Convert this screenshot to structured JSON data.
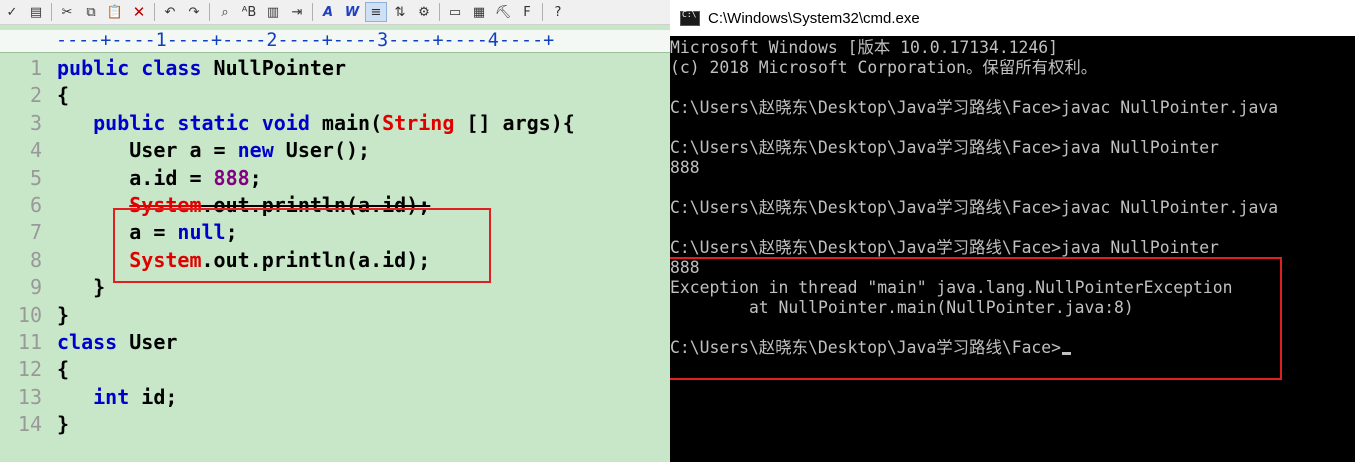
{
  "editor": {
    "toolbar": [
      {
        "name": "spellcheck-icon",
        "glyph": "✓"
      },
      {
        "name": "print-preview-icon",
        "glyph": "▤"
      },
      {
        "name": "cut-icon",
        "glyph": "✂"
      },
      {
        "name": "copy-icon",
        "glyph": "⧉"
      },
      {
        "name": "paste-icon",
        "glyph": "📋"
      },
      {
        "name": "delete-icon",
        "glyph": "✕"
      },
      {
        "name": "undo-icon",
        "glyph": "↶"
      },
      {
        "name": "redo-icon",
        "glyph": "↷"
      },
      {
        "name": "find-icon",
        "glyph": "⌕"
      },
      {
        "name": "replace-icon",
        "glyph": "ᴬB"
      },
      {
        "name": "copy-block-icon",
        "glyph": "▥"
      },
      {
        "name": "indent-icon",
        "glyph": "⇥"
      },
      {
        "name": "font-icon",
        "glyph": "A"
      },
      {
        "name": "word-wrap-icon",
        "glyph": "W"
      },
      {
        "name": "align-icon",
        "glyph": "≡"
      },
      {
        "name": "sort-icon",
        "glyph": "⇅"
      },
      {
        "name": "settings-icon",
        "glyph": "⚙"
      },
      {
        "name": "view-icon",
        "glyph": "▭"
      },
      {
        "name": "column-icon",
        "glyph": "▦"
      },
      {
        "name": "tools-icon",
        "glyph": "⛏"
      },
      {
        "name": "file-icon",
        "glyph": "F"
      },
      {
        "name": "help-icon",
        "glyph": "?"
      }
    ],
    "ruler": "----+----1----+----2----+----3----+----4----+",
    "lines": [
      {
        "num": "1",
        "segments": [
          {
            "t": "public class ",
            "c": "kw"
          },
          {
            "t": "NullPointer",
            "c": ""
          }
        ]
      },
      {
        "num": "2",
        "segments": [
          {
            "t": "{",
            "c": ""
          }
        ]
      },
      {
        "num": "3",
        "segments": [
          {
            "t": "   public static void ",
            "c": "kw"
          },
          {
            "t": "main(",
            "c": ""
          },
          {
            "t": "String",
            "c": "ty"
          },
          {
            "t": " [] args){",
            "c": ""
          }
        ]
      },
      {
        "num": "4",
        "segments": [
          {
            "t": "      User a = ",
            "c": ""
          },
          {
            "t": "new",
            "c": "kw"
          },
          {
            "t": " User();",
            "c": ""
          }
        ]
      },
      {
        "num": "5",
        "segments": [
          {
            "t": "      a.id = ",
            "c": ""
          },
          {
            "t": "888",
            "c": "num"
          },
          {
            "t": ";",
            "c": ""
          }
        ]
      },
      {
        "num": "6",
        "segments": [
          {
            "t": "      ",
            "c": ""
          },
          {
            "t": "System",
            "c": "ty strike"
          },
          {
            "t": ".out.println(a.id);",
            "c": "strike"
          }
        ]
      },
      {
        "num": "7",
        "segments": [
          {
            "t": "      a = ",
            "c": ""
          },
          {
            "t": "null",
            "c": "kw"
          },
          {
            "t": ";",
            "c": ""
          }
        ]
      },
      {
        "num": "8",
        "segments": [
          {
            "t": "      ",
            "c": ""
          },
          {
            "t": "System",
            "c": "ty"
          },
          {
            "t": ".out.println(a.id);",
            "c": ""
          }
        ]
      },
      {
        "num": "9",
        "segments": [
          {
            "t": "   }",
            "c": ""
          }
        ]
      },
      {
        "num": "10",
        "segments": [
          {
            "t": "}",
            "c": ""
          }
        ]
      },
      {
        "num": "11",
        "segments": [
          {
            "t": "class ",
            "c": "kw"
          },
          {
            "t": "User",
            "c": ""
          }
        ]
      },
      {
        "num": "12",
        "segments": [
          {
            "t": "{",
            "c": ""
          }
        ]
      },
      {
        "num": "13",
        "segments": [
          {
            "t": "   ",
            "c": ""
          },
          {
            "t": "int",
            "c": "kw"
          },
          {
            "t": " id;",
            "c": ""
          }
        ]
      },
      {
        "num": "14",
        "segments": [
          {
            "t": "}",
            "c": ""
          }
        ]
      }
    ]
  },
  "cmd": {
    "title": "C:\\Windows\\System32\\cmd.exe",
    "lines": [
      "Microsoft Windows [版本 10.0.17134.1246]",
      "(c) 2018 Microsoft Corporation。保留所有权利。",
      "",
      "C:\\Users\\赵晓东\\Desktop\\Java学习路线\\Face>javac NullPointer.java",
      "",
      "C:\\Users\\赵晓东\\Desktop\\Java学习路线\\Face>java NullPointer",
      "888",
      "",
      "C:\\Users\\赵晓东\\Desktop\\Java学习路线\\Face>javac NullPointer.java",
      "",
      "C:\\Users\\赵晓东\\Desktop\\Java学习路线\\Face>java NullPointer",
      "888",
      "Exception in thread \"main\" java.lang.NullPointerException",
      "        at NullPointer.main(NullPointer.java:8)",
      "",
      "C:\\Users\\赵晓东\\Desktop\\Java学习路线\\Face>"
    ]
  },
  "colors": {
    "editor_bg": "#c8e6c8",
    "keyword": "#0000cc",
    "type": "#e00000",
    "number": "#800080",
    "highlight_box": "#e02020",
    "console_bg": "#000000",
    "console_fg": "#c0c0c0"
  }
}
